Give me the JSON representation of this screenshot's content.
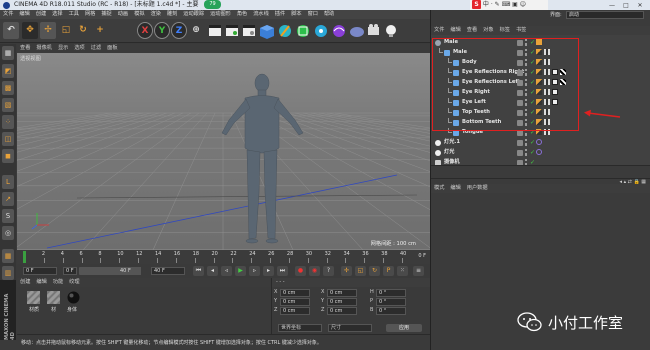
{
  "window": {
    "title": "CINEMA 4D R18.011 Studio (RC - R18) - [未标题 1.c4d *] - 主要",
    "badge": "79",
    "controls": [
      "—",
      "□",
      "✕"
    ]
  },
  "ime": {
    "logo": "S",
    "label": "中"
  },
  "layout": {
    "label": "界面:",
    "value": "启动"
  },
  "menubar": [
    "文件",
    "编辑",
    "创建",
    "选择",
    "工具",
    "网格",
    "捕捉",
    "动画",
    "模拟",
    "渲染",
    "雕刻",
    "运动跟踪",
    "运动图形",
    "角色",
    "流水线",
    "插件",
    "脚本",
    "窗口",
    "帮助"
  ],
  "toolbar": {
    "items": [
      {
        "name": "undo",
        "glyph": "↶"
      },
      {
        "name": "live-select",
        "glyph": "✥"
      },
      {
        "name": "move",
        "glyph": "✢"
      },
      {
        "name": "scale",
        "glyph": "◱"
      },
      {
        "name": "rotate",
        "glyph": "↻"
      },
      {
        "name": "recent",
        "glyph": "+"
      },
      {
        "name": "x-axis",
        "glyph": "X"
      },
      {
        "name": "y-axis",
        "glyph": "Y"
      },
      {
        "name": "z-axis",
        "glyph": "Z"
      },
      {
        "name": "coord",
        "glyph": "⊕"
      }
    ]
  },
  "viewport": {
    "menu": [
      "查看",
      "摄像机",
      "显示",
      "选项",
      "过滤",
      "面板"
    ],
    "label": "透视视图",
    "grid_spacing": "网格间距 : 100 cm"
  },
  "timeline": {
    "ticks": [
      "0",
      "2",
      "4",
      "6",
      "8",
      "10",
      "12",
      "14",
      "16",
      "18",
      "20",
      "22",
      "24",
      "26",
      "28",
      "30",
      "32",
      "34",
      "36",
      "38",
      "40"
    ],
    "end_label": "0 F"
  },
  "transport": {
    "start": "0 F",
    "current": "0 F",
    "end": "40 F",
    "end2": "40 F"
  },
  "materials": {
    "menu": [
      "创建",
      "编辑",
      "功能",
      "纹理"
    ],
    "items": [
      "材质",
      "材",
      "身体"
    ]
  },
  "coords": {
    "rows": [
      {
        "axis": "X",
        "pos": "0 cm",
        "size": "0 cm",
        "h": "H",
        "hv": "0 °"
      },
      {
        "axis": "Y",
        "pos": "0 cm",
        "size": "0 cm",
        "h": "P",
        "hv": "0 °"
      },
      {
        "axis": "Z",
        "pos": "0 cm",
        "size": "0 cm",
        "h": "B",
        "hv": "0 °"
      }
    ],
    "mode1": "世界坐标",
    "mode2": "尺寸",
    "apply": "应用"
  },
  "statusbar": "移动：点击并拖动鼠标移动元素。按住 SHIFT 键量化移动；节点编辑模式时按住 SHIFT 键增加选择对象；按住 CTRL 键减少选择对象。",
  "maxon": "MAXON CINEMA 4D",
  "objects": {
    "menu": [
      "文件",
      "编辑",
      "查看",
      "对象",
      "标签",
      "书签"
    ],
    "rows": [
      {
        "name": "Male",
        "indent": 0,
        "icon": "null"
      },
      {
        "name": "Male",
        "indent": 1,
        "icon": "poly"
      },
      {
        "name": "Body",
        "indent": 2,
        "icon": "poly"
      },
      {
        "name": "Eye Reflections Right",
        "indent": 2,
        "icon": "poly"
      },
      {
        "name": "Eye Reflections Left",
        "indent": 2,
        "icon": "poly"
      },
      {
        "name": "Eye Right",
        "indent": 2,
        "icon": "poly"
      },
      {
        "name": "Eye Left",
        "indent": 2,
        "icon": "poly"
      },
      {
        "name": "Top Teeth",
        "indent": 2,
        "icon": "poly"
      },
      {
        "name": "Bottom Teeth",
        "indent": 2,
        "icon": "poly"
      },
      {
        "name": "Tongue",
        "indent": 2,
        "icon": "poly"
      },
      {
        "name": "灯光.1",
        "indent": 0,
        "icon": "light"
      },
      {
        "name": "灯光",
        "indent": 0,
        "icon": "light"
      },
      {
        "name": "摄像机",
        "indent": 0,
        "icon": "camera"
      }
    ]
  },
  "attributes": {
    "menu": [
      "模式",
      "编辑",
      "用户数据"
    ]
  },
  "watermark": "小付工作室",
  "colors": {
    "accent": "#e8a23a",
    "highlight": "#e02020",
    "axis_x": "#d04040",
    "axis_y": "#40c040",
    "axis_z": "#4060e0"
  }
}
